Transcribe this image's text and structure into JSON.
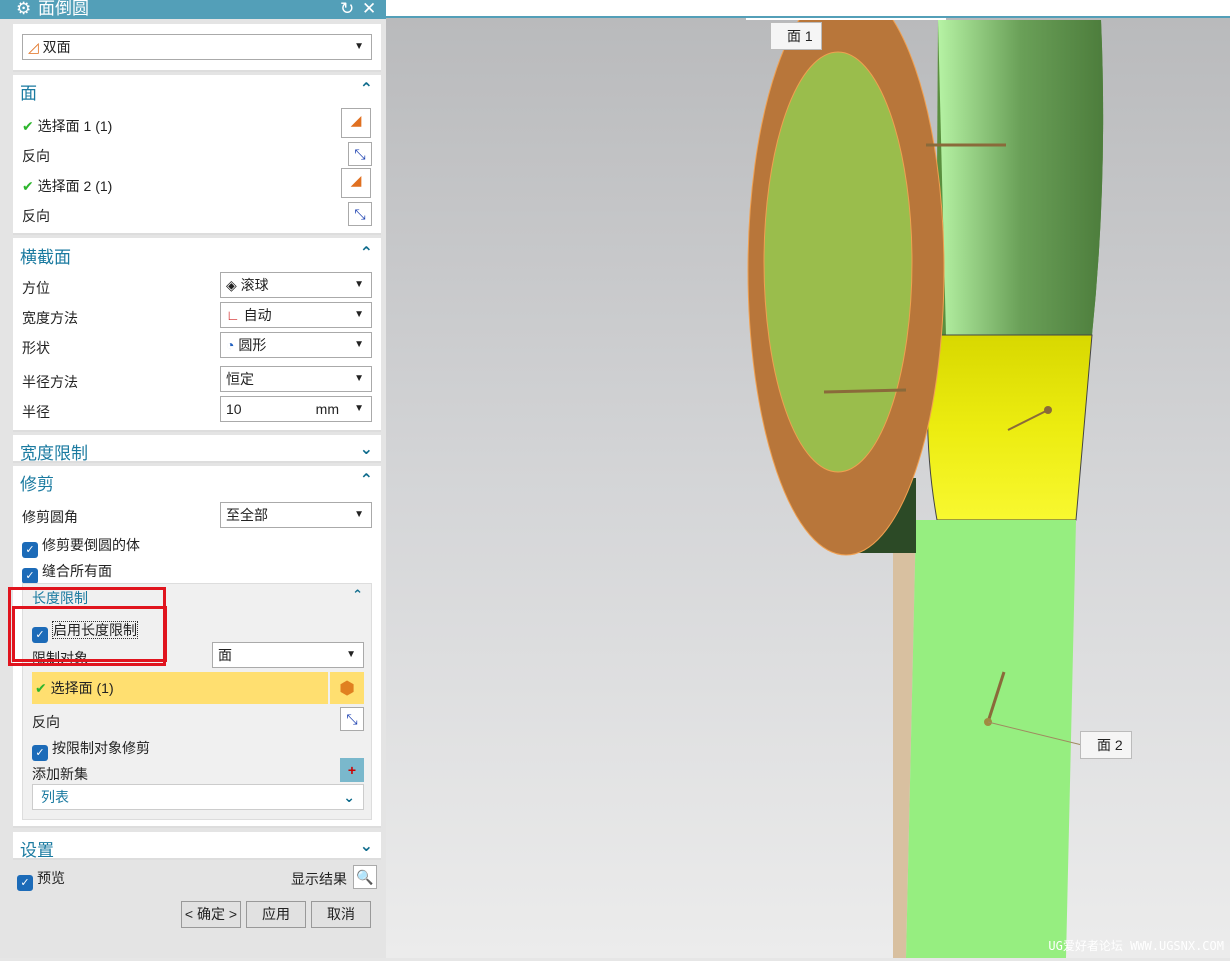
{
  "title": "面倒圆",
  "type_select": "双面",
  "face": {
    "header": "面",
    "select1": "选择面 1 (1)",
    "reverse1": "反向",
    "select2": "选择面 2 (1)",
    "reverse2": "反向"
  },
  "cross": {
    "header": "横截面",
    "orient_label": "方位",
    "orient": "滚球",
    "width_label": "宽度方法",
    "width": "自动",
    "shape_label": "形状",
    "shape": "圆形",
    "radius_method_label": "半径方法",
    "radius_method": "恒定",
    "radius_label": "半径",
    "radius": "10",
    "unit": "mm"
  },
  "width_limit": {
    "header": "宽度限制"
  },
  "trim": {
    "header": "修剪",
    "trim_label": "修剪圆角",
    "trim_value": "至全部",
    "trim_body": "修剪要倒圆的体",
    "sew": "缝合所有面"
  },
  "length": {
    "header": "长度限制",
    "enable": "启用长度限制",
    "target_label": "限制对象",
    "target": "面",
    "select": "选择面 (1)",
    "reverse": "反向",
    "trim_by": "按限制对象修剪",
    "add_set": "添加新集",
    "list": "列表"
  },
  "settings": {
    "header": "设置"
  },
  "preview": "预览",
  "show_result": "显示结果",
  "buttons": {
    "ok": "< 确定 >",
    "apply": "应用",
    "cancel": "取消"
  },
  "viewport": {
    "label1": "面 1",
    "label2": "面 2",
    "watermark": "UG爱好者论坛 WWW.UGSNX.COM"
  }
}
